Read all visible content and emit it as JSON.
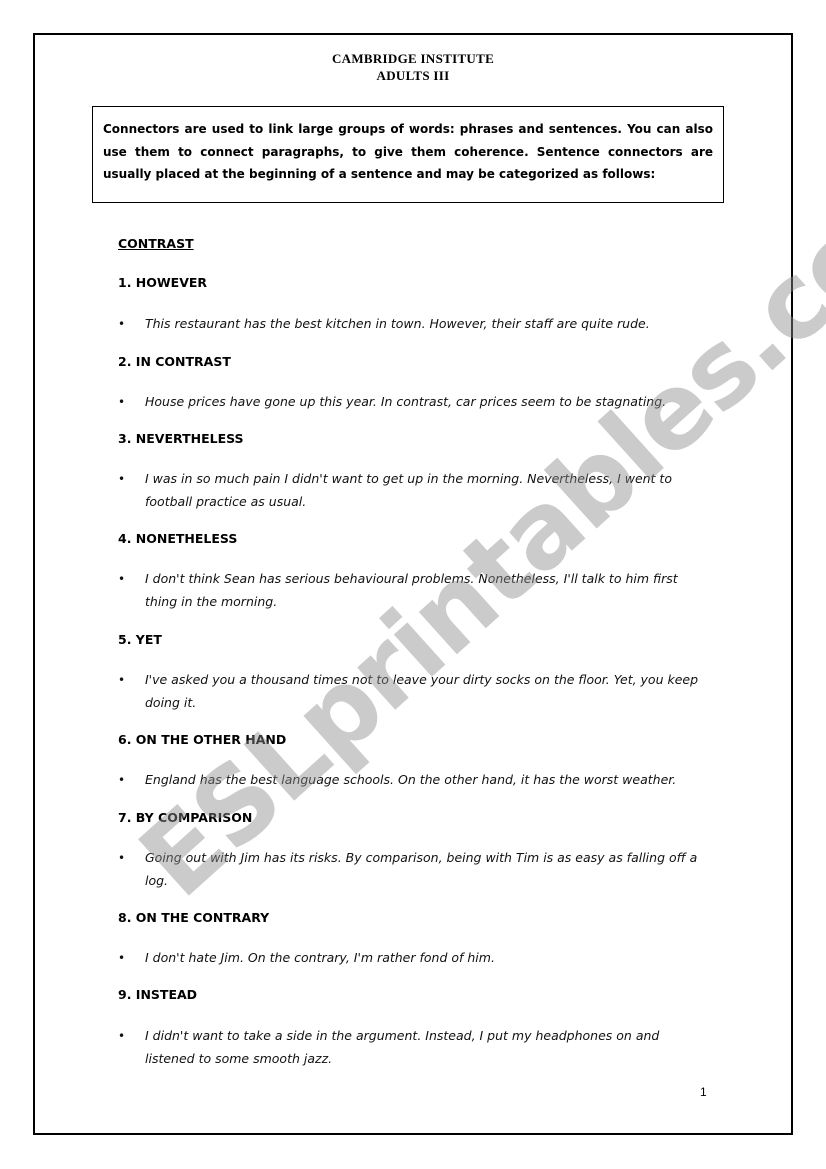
{
  "header": {
    "line1": "CAMBRIDGE INSTITUTE",
    "line2": "ADULTS III"
  },
  "intro": {
    "text": "Connectors  are used to link large groups of words: phrases and sentences. You can also use them to connect paragraphs, to give them coherence. Sentence connectors are usually placed at the beginning of a sentence and may be categorized as follows:"
  },
  "section": {
    "title": "CONTRAST"
  },
  "items": [
    {
      "heading": "1. HOWEVER",
      "bullet": "•",
      "example": "This restaurant has the best kitchen in town. However, their staff are quite rude."
    },
    {
      "heading": "2. IN CONTRAST",
      "bullet": "•",
      "example": "House prices have gone up this year. In contrast, car prices seem to be stagnating."
    },
    {
      "heading": "3. NEVERTHELESS",
      "bullet": "•",
      "example": "I was in so much pain I didn't want to get up in the morning. Nevertheless, I went to football practice as usual."
    },
    {
      "heading": "4. NONETHELESS",
      "bullet": "•",
      "example": "I don't think Sean has serious behavioural problems. Nonetheless, I'll talk to him first thing in the morning."
    },
    {
      "heading": "5. YET",
      "bullet": "•",
      "example": "I've asked you a thousand times not to leave your dirty socks on the floor. Yet, you keep doing it."
    },
    {
      "heading": "6. ON THE OTHER HAND",
      "bullet": "•",
      "example": "England has the best language schools. On the other hand, it has the worst weather."
    },
    {
      "heading": "7. BY COMPARISON",
      "bullet": "•",
      "example": "Going out with Jim has its risks. By comparison, being with Tim is as easy as falling off a log."
    },
    {
      "heading": "8. ON THE CONTRARY",
      "bullet": "•",
      "example": "I don't hate Jim. On the contrary, I'm rather fond of him."
    },
    {
      "heading": "9. INSTEAD",
      "bullet": "•",
      "example": "I didn't want to take a side in the argument. Instead, I put my headphones on and listened to some smooth jazz."
    }
  ],
  "footer": {
    "page_number": "1"
  },
  "watermark": {
    "text": "ESLprintables.com"
  }
}
